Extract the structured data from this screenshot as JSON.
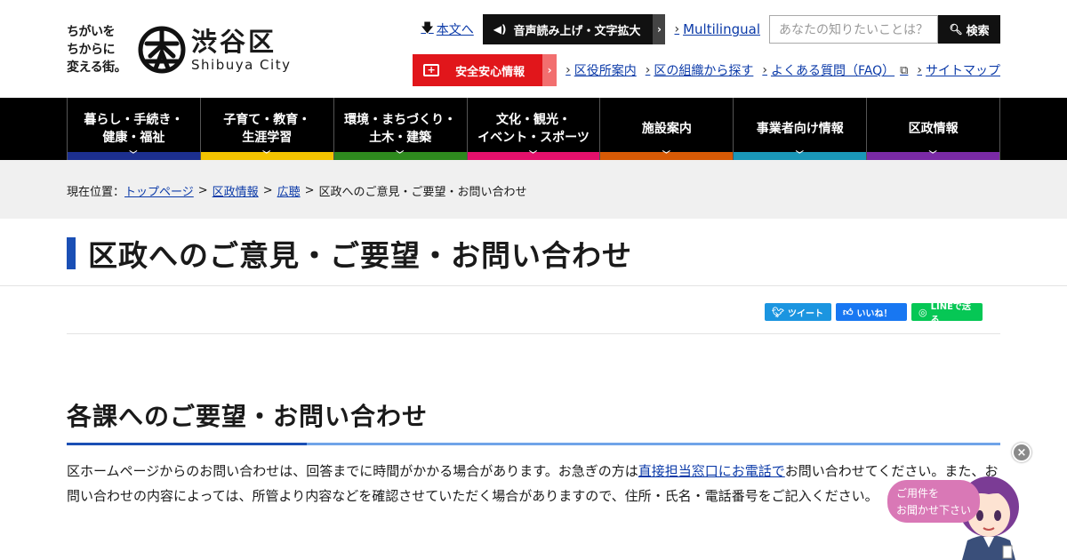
{
  "header": {
    "tagline": "ちがいを\nちからに\n変える街。",
    "city_name_jp": "渋谷区",
    "city_name_en": "Shibuya City",
    "skip_link": "本文へ",
    "voice_button": "音声読み上げ・文字拡大",
    "multilingual": "Multilingual",
    "search_placeholder": "あなたの知りたいことは？",
    "search_button": "検索",
    "safety_button": "安全安心情報",
    "links": [
      "区役所案内",
      "区の組織から探す",
      "よくある質問（FAQ）",
      "サイトマップ"
    ]
  },
  "gnav": [
    {
      "label": "暮らし・手続き・\n健康・福祉",
      "color": "#1c2f8f"
    },
    {
      "label": "子育て・教育・\n生涯学習",
      "color": "#f5c400"
    },
    {
      "label": "環境・まちづくり・\n土木・建築",
      "color": "#2e8a1e"
    },
    {
      "label": "文化・観光・\nイベント・スポーツ",
      "color": "#e4106b"
    },
    {
      "label": "施設案内",
      "color": "#d85a05"
    },
    {
      "label": "事業者向け情報",
      "color": "#1a97b8"
    },
    {
      "label": "区政情報",
      "color": "#7a2aa6"
    }
  ],
  "breadcrumb": {
    "prefix": "現在位置：",
    "items": [
      "トップページ",
      "区政情報",
      "広聴"
    ],
    "current": "区政へのご意見・ご要望・お問い合わせ",
    "separator": ">"
  },
  "page_title": "区政へのご意見・ご要望・お問い合わせ",
  "social": {
    "tweet": "ツイート",
    "like": "いいね！",
    "line": "LINEで送る"
  },
  "section": {
    "title": "各課へのご要望・お問い合わせ",
    "text_before": "区ホームページからのお問い合わせは、回答までに時間がかかる場合があります。お急ぎの方は",
    "link": "直接担当窓口にお電話で",
    "text_after": "お問い合わせてください。また、お問い合わせの内容によっては、所管より内容などを確認させていただく場合がありますので、住所・氏名・電話番号をご記入ください。"
  },
  "chat": {
    "close": "×",
    "bubble": "ご用件を\nお聞かせ下さい"
  }
}
